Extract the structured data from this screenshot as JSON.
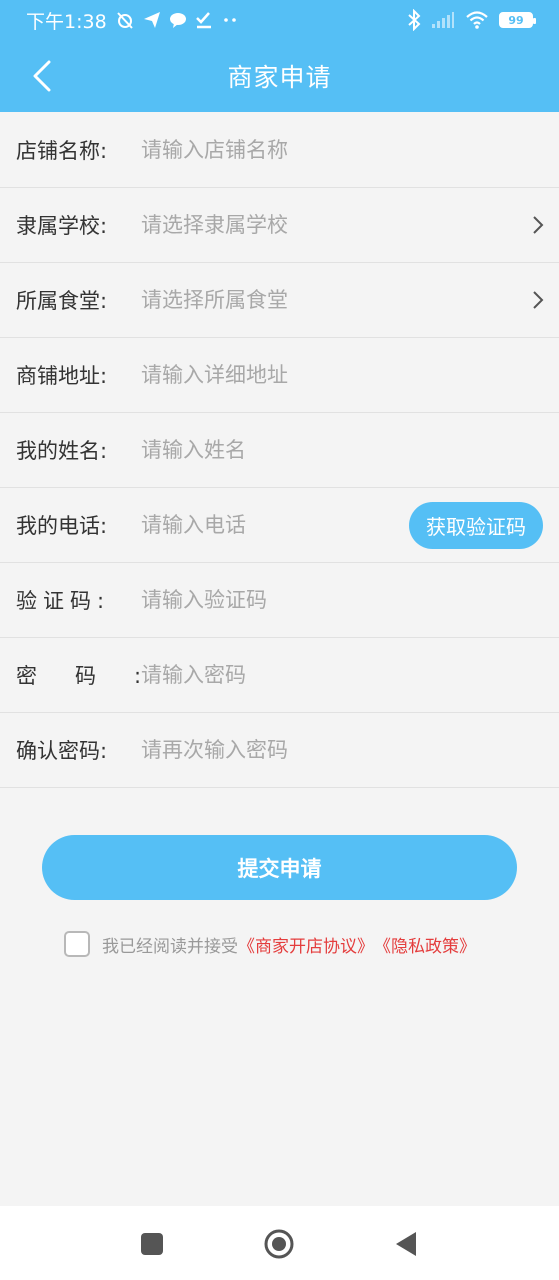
{
  "status_bar": {
    "time": "下午1:38",
    "battery": "99"
  },
  "header": {
    "title": "商家申请"
  },
  "form": {
    "rows": [
      {
        "label": "店铺名称:",
        "placeholder": "请输入店铺名称"
      },
      {
        "label": "隶属学校:",
        "placeholder": "请选择隶属学校"
      },
      {
        "label": "所属食堂:",
        "placeholder": "请选择所属食堂"
      },
      {
        "label": "商铺地址:",
        "placeholder": "请输入详细地址"
      },
      {
        "label": "我的姓名:",
        "placeholder": "请输入姓名"
      },
      {
        "label": "我的电话:",
        "placeholder": "请输入电话"
      },
      {
        "label": "验证码:",
        "placeholder": "请输入验证码"
      },
      {
        "label": "密码:",
        "placeholder": "请输入密码"
      },
      {
        "label": "确认密码:",
        "placeholder": "请再次输入密码"
      }
    ],
    "get_code_label": "获取验证码"
  },
  "submit_label": "提交申请",
  "agreement": {
    "text": "我已经阅读并接受",
    "link1": "《商家开店协议》",
    "link2": "《隐私政策》"
  },
  "colors": {
    "primary": "#55bff5",
    "link": "#e43d3d"
  }
}
